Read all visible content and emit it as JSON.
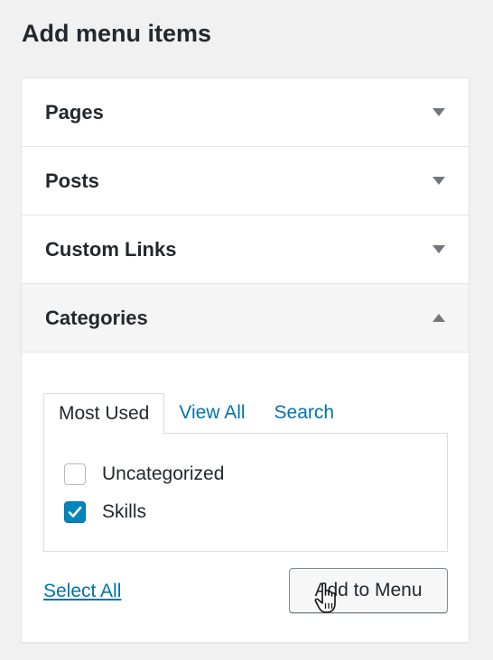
{
  "page": {
    "heading": "Add menu items"
  },
  "sections": [
    {
      "label": "Pages",
      "expanded": false
    },
    {
      "label": "Posts",
      "expanded": false
    },
    {
      "label": "Custom Links",
      "expanded": false
    },
    {
      "label": "Categories",
      "expanded": true
    }
  ],
  "categories": {
    "tabs": [
      {
        "label": "Most Used",
        "active": true
      },
      {
        "label": "View All",
        "active": false
      },
      {
        "label": "Search",
        "active": false
      }
    ],
    "items": [
      {
        "label": "Uncategorized",
        "checked": false
      },
      {
        "label": "Skills",
        "checked": true
      }
    ],
    "select_all_label": "Select All",
    "add_button_label": "Add to Menu"
  },
  "colors": {
    "link": "#0073aa",
    "checkbox_checked": "#0085ba",
    "text": "#23282d"
  }
}
